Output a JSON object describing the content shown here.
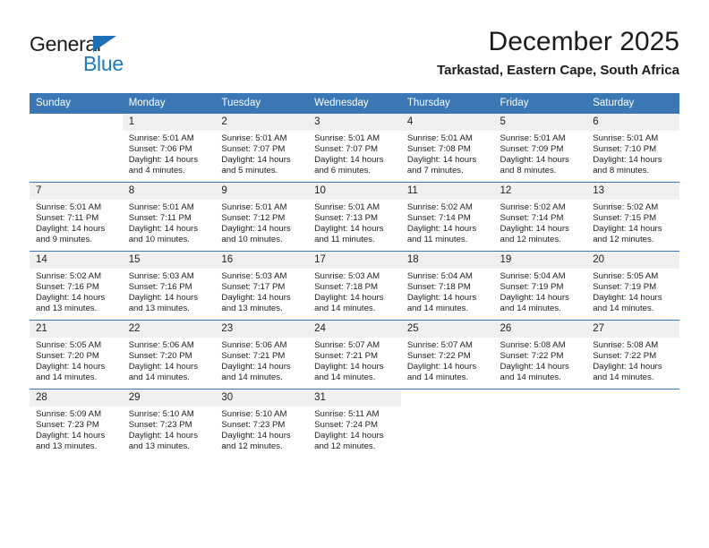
{
  "logo": {
    "word1": "General",
    "word2": "Blue",
    "triangle_color": "#1d70b8",
    "word2_color": "#1d7bc4"
  },
  "header": {
    "title": "December 2025",
    "subtitle": "Tarkastad, Eastern Cape, South Africa",
    "header_bg_color": "#3b77b5"
  },
  "weekdays": [
    "Sunday",
    "Monday",
    "Tuesday",
    "Wednesday",
    "Thursday",
    "Friday",
    "Saturday"
  ],
  "weeks": [
    [
      {
        "day": "",
        "sunrise": "",
        "sunset": "",
        "daylight1": "",
        "daylight2": ""
      },
      {
        "day": "1",
        "sunrise": "Sunrise: 5:01 AM",
        "sunset": "Sunset: 7:06 PM",
        "daylight1": "Daylight: 14 hours",
        "daylight2": "and 4 minutes."
      },
      {
        "day": "2",
        "sunrise": "Sunrise: 5:01 AM",
        "sunset": "Sunset: 7:07 PM",
        "daylight1": "Daylight: 14 hours",
        "daylight2": "and 5 minutes."
      },
      {
        "day": "3",
        "sunrise": "Sunrise: 5:01 AM",
        "sunset": "Sunset: 7:07 PM",
        "daylight1": "Daylight: 14 hours",
        "daylight2": "and 6 minutes."
      },
      {
        "day": "4",
        "sunrise": "Sunrise: 5:01 AM",
        "sunset": "Sunset: 7:08 PM",
        "daylight1": "Daylight: 14 hours",
        "daylight2": "and 7 minutes."
      },
      {
        "day": "5",
        "sunrise": "Sunrise: 5:01 AM",
        "sunset": "Sunset: 7:09 PM",
        "daylight1": "Daylight: 14 hours",
        "daylight2": "and 8 minutes."
      },
      {
        "day": "6",
        "sunrise": "Sunrise: 5:01 AM",
        "sunset": "Sunset: 7:10 PM",
        "daylight1": "Daylight: 14 hours",
        "daylight2": "and 8 minutes."
      }
    ],
    [
      {
        "day": "7",
        "sunrise": "Sunrise: 5:01 AM",
        "sunset": "Sunset: 7:11 PM",
        "daylight1": "Daylight: 14 hours",
        "daylight2": "and 9 minutes."
      },
      {
        "day": "8",
        "sunrise": "Sunrise: 5:01 AM",
        "sunset": "Sunset: 7:11 PM",
        "daylight1": "Daylight: 14 hours",
        "daylight2": "and 10 minutes."
      },
      {
        "day": "9",
        "sunrise": "Sunrise: 5:01 AM",
        "sunset": "Sunset: 7:12 PM",
        "daylight1": "Daylight: 14 hours",
        "daylight2": "and 10 minutes."
      },
      {
        "day": "10",
        "sunrise": "Sunrise: 5:01 AM",
        "sunset": "Sunset: 7:13 PM",
        "daylight1": "Daylight: 14 hours",
        "daylight2": "and 11 minutes."
      },
      {
        "day": "11",
        "sunrise": "Sunrise: 5:02 AM",
        "sunset": "Sunset: 7:14 PM",
        "daylight1": "Daylight: 14 hours",
        "daylight2": "and 11 minutes."
      },
      {
        "day": "12",
        "sunrise": "Sunrise: 5:02 AM",
        "sunset": "Sunset: 7:14 PM",
        "daylight1": "Daylight: 14 hours",
        "daylight2": "and 12 minutes."
      },
      {
        "day": "13",
        "sunrise": "Sunrise: 5:02 AM",
        "sunset": "Sunset: 7:15 PM",
        "daylight1": "Daylight: 14 hours",
        "daylight2": "and 12 minutes."
      }
    ],
    [
      {
        "day": "14",
        "sunrise": "Sunrise: 5:02 AM",
        "sunset": "Sunset: 7:16 PM",
        "daylight1": "Daylight: 14 hours",
        "daylight2": "and 13 minutes."
      },
      {
        "day": "15",
        "sunrise": "Sunrise: 5:03 AM",
        "sunset": "Sunset: 7:16 PM",
        "daylight1": "Daylight: 14 hours",
        "daylight2": "and 13 minutes."
      },
      {
        "day": "16",
        "sunrise": "Sunrise: 5:03 AM",
        "sunset": "Sunset: 7:17 PM",
        "daylight1": "Daylight: 14 hours",
        "daylight2": "and 13 minutes."
      },
      {
        "day": "17",
        "sunrise": "Sunrise: 5:03 AM",
        "sunset": "Sunset: 7:18 PM",
        "daylight1": "Daylight: 14 hours",
        "daylight2": "and 14 minutes."
      },
      {
        "day": "18",
        "sunrise": "Sunrise: 5:04 AM",
        "sunset": "Sunset: 7:18 PM",
        "daylight1": "Daylight: 14 hours",
        "daylight2": "and 14 minutes."
      },
      {
        "day": "19",
        "sunrise": "Sunrise: 5:04 AM",
        "sunset": "Sunset: 7:19 PM",
        "daylight1": "Daylight: 14 hours",
        "daylight2": "and 14 minutes."
      },
      {
        "day": "20",
        "sunrise": "Sunrise: 5:05 AM",
        "sunset": "Sunset: 7:19 PM",
        "daylight1": "Daylight: 14 hours",
        "daylight2": "and 14 minutes."
      }
    ],
    [
      {
        "day": "21",
        "sunrise": "Sunrise: 5:05 AM",
        "sunset": "Sunset: 7:20 PM",
        "daylight1": "Daylight: 14 hours",
        "daylight2": "and 14 minutes."
      },
      {
        "day": "22",
        "sunrise": "Sunrise: 5:06 AM",
        "sunset": "Sunset: 7:20 PM",
        "daylight1": "Daylight: 14 hours",
        "daylight2": "and 14 minutes."
      },
      {
        "day": "23",
        "sunrise": "Sunrise: 5:06 AM",
        "sunset": "Sunset: 7:21 PM",
        "daylight1": "Daylight: 14 hours",
        "daylight2": "and 14 minutes."
      },
      {
        "day": "24",
        "sunrise": "Sunrise: 5:07 AM",
        "sunset": "Sunset: 7:21 PM",
        "daylight1": "Daylight: 14 hours",
        "daylight2": "and 14 minutes."
      },
      {
        "day": "25",
        "sunrise": "Sunrise: 5:07 AM",
        "sunset": "Sunset: 7:22 PM",
        "daylight1": "Daylight: 14 hours",
        "daylight2": "and 14 minutes."
      },
      {
        "day": "26",
        "sunrise": "Sunrise: 5:08 AM",
        "sunset": "Sunset: 7:22 PM",
        "daylight1": "Daylight: 14 hours",
        "daylight2": "and 14 minutes."
      },
      {
        "day": "27",
        "sunrise": "Sunrise: 5:08 AM",
        "sunset": "Sunset: 7:22 PM",
        "daylight1": "Daylight: 14 hours",
        "daylight2": "and 14 minutes."
      }
    ],
    [
      {
        "day": "28",
        "sunrise": "Sunrise: 5:09 AM",
        "sunset": "Sunset: 7:23 PM",
        "daylight1": "Daylight: 14 hours",
        "daylight2": "and 13 minutes."
      },
      {
        "day": "29",
        "sunrise": "Sunrise: 5:10 AM",
        "sunset": "Sunset: 7:23 PM",
        "daylight1": "Daylight: 14 hours",
        "daylight2": "and 13 minutes."
      },
      {
        "day": "30",
        "sunrise": "Sunrise: 5:10 AM",
        "sunset": "Sunset: 7:23 PM",
        "daylight1": "Daylight: 14 hours",
        "daylight2": "and 12 minutes."
      },
      {
        "day": "31",
        "sunrise": "Sunrise: 5:11 AM",
        "sunset": "Sunset: 7:24 PM",
        "daylight1": "Daylight: 14 hours",
        "daylight2": "and 12 minutes."
      },
      {
        "day": "",
        "sunrise": "",
        "sunset": "",
        "daylight1": "",
        "daylight2": ""
      },
      {
        "day": "",
        "sunrise": "",
        "sunset": "",
        "daylight1": "",
        "daylight2": ""
      },
      {
        "day": "",
        "sunrise": "",
        "sunset": "",
        "daylight1": "",
        "daylight2": ""
      }
    ]
  ]
}
